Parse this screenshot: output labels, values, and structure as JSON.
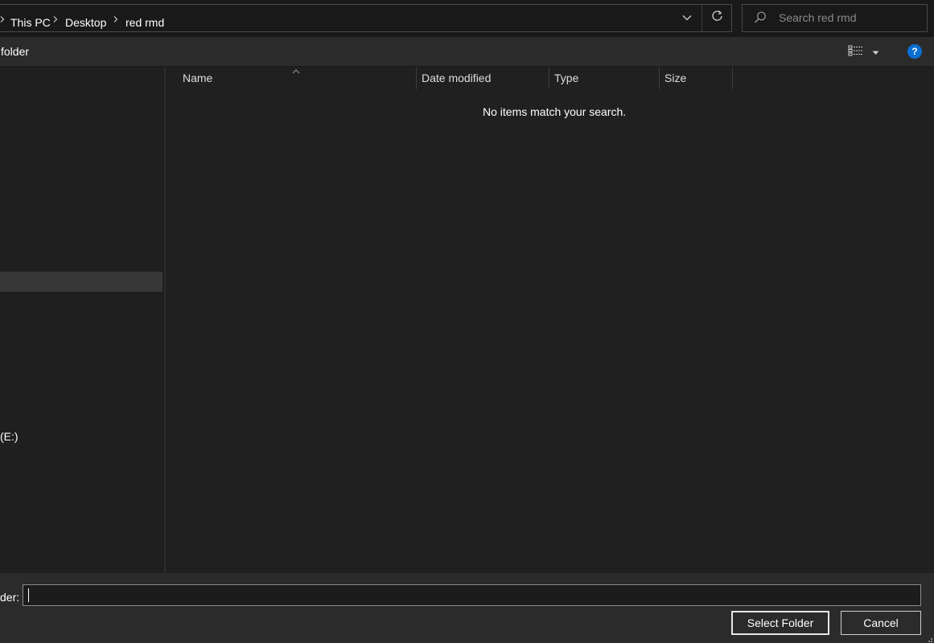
{
  "breadcrumb": {
    "items": [
      "This PC",
      "Desktop",
      "red rmd"
    ]
  },
  "search": {
    "placeholder": "Search red rmd"
  },
  "command_bar": {
    "new_folder_label": "folder",
    "help_label": "?"
  },
  "nav_pane": {
    "drive_label": "(E:)"
  },
  "file_list": {
    "columns": [
      "Name",
      "Date modified",
      "Type",
      "Size"
    ],
    "sorted_column": "Name",
    "empty_message": "No items match your search."
  },
  "footer": {
    "folder_label": "der:",
    "folder_value": "",
    "select_button": "Select Folder",
    "cancel_button": "Cancel"
  },
  "icons": {
    "breadcrumb_separator": "chevron-right-icon",
    "address_dropdown": "chevron-down-icon",
    "refresh": "refresh-icon",
    "search": "search-icon",
    "view": "details-view-icon",
    "help": "help-icon"
  },
  "colors": {
    "background": "#191919",
    "pane": "#202020",
    "toolbar": "#2b2b2b",
    "accent": "#0a6ed1",
    "selection": "#373737"
  }
}
